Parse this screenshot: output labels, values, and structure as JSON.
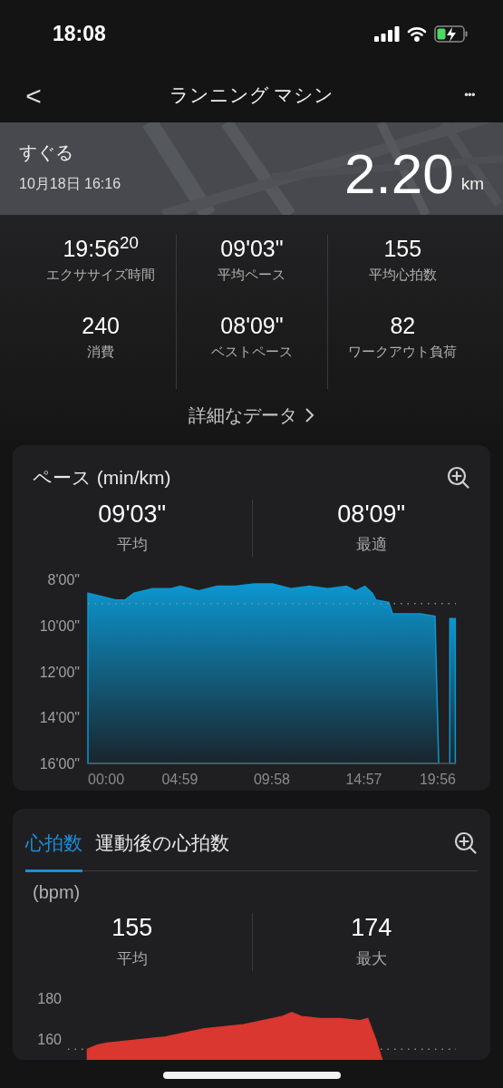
{
  "status_bar": {
    "time": "18:08"
  },
  "nav": {
    "back": "<",
    "title": "ランニング マシン",
    "more": "•••"
  },
  "summary": {
    "kind": "picture",
    "name": "すぐる",
    "date": "10月18日 16:16",
    "distance": "2.20",
    "unit": "km"
  },
  "stats": [
    {
      "value": "19:56$^{20}$",
      "label": "エクササイズ時間"
    },
    {
      "value": "09'03\"",
      "label": "平均ペース"
    },
    {
      "value": "155",
      "label": "平均心拍数"
    },
    {
      "value": "240",
      "label": "消費"
    },
    {
      "value": "08'09\"",
      "label": "ベストペース"
    },
    {
      "value": "82",
      "label": "ワークアウト負荷"
    }
  ],
  "details_link": "詳細なデータ",
  "pace_card": {
    "title": "ペース (min/km)",
    "stats": [
      {
        "value": "09'03\"",
        "label": "平均"
      },
      {
        "value": "08'09\"",
        "label": "最適"
      }
    ],
    "y_axis_labels": [
      "8'00\"",
      "10'00\"",
      "12'00\"",
      "14'00\"",
      "16'00\""
    ],
    "x_axis_labels": [
      "00:00",
      "04:59",
      "09:58",
      "14:57",
      "19:56"
    ]
  },
  "hr_card": {
    "tabs": [
      {
        "label": "心拍数",
        "selected": true
      },
      {
        "label": "運動後の心拍数",
        "selected": false
      }
    ],
    "unit": "(bpm)",
    "stats": [
      {
        "value": "155",
        "label": "平均"
      },
      {
        "value": "174",
        "label": "最大"
      }
    ],
    "y_axis_labels": [
      "180",
      "160"
    ]
  }
}
